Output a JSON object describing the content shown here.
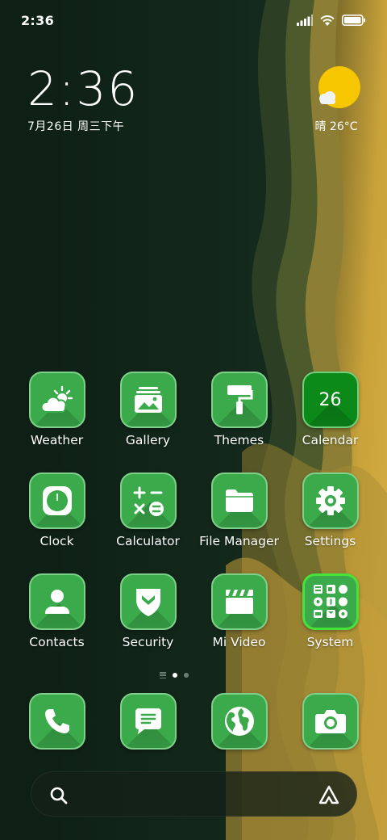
{
  "status_bar": {
    "time": "2:36",
    "icons": [
      "signal-icon",
      "wifi-icon",
      "battery-icon"
    ]
  },
  "clock_widget": {
    "time": "2:36",
    "date": "7月26日 周三下午"
  },
  "weather_widget": {
    "condition_icon": "sunny-cloud-icon",
    "text": "晴 26°C"
  },
  "apps": [
    {
      "id": "weather",
      "label": "Weather",
      "icon": "weather-icon"
    },
    {
      "id": "gallery",
      "label": "Gallery",
      "icon": "gallery-icon"
    },
    {
      "id": "themes",
      "label": "Themes",
      "icon": "paint-roller-icon"
    },
    {
      "id": "calendar",
      "label": "Calendar",
      "icon": "calendar-icon",
      "day": "26"
    },
    {
      "id": "clock",
      "label": "Clock",
      "icon": "clock-icon"
    },
    {
      "id": "calculator",
      "label": "Calculator",
      "icon": "calculator-icon"
    },
    {
      "id": "file-manager",
      "label": "File Manager",
      "icon": "folder-icon"
    },
    {
      "id": "settings",
      "label": "Settings",
      "icon": "gear-icon"
    },
    {
      "id": "contacts",
      "label": "Contacts",
      "icon": "person-icon"
    },
    {
      "id": "security",
      "label": "Security",
      "icon": "shield-icon"
    },
    {
      "id": "mi-video",
      "label": "Mi Video",
      "icon": "clapperboard-icon"
    },
    {
      "id": "system",
      "label": "System",
      "icon": "folder-grid-icon"
    }
  ],
  "page_indicator": {
    "pages": 2,
    "current": 1
  },
  "dock": [
    {
      "id": "phone",
      "icon": "phone-icon"
    },
    {
      "id": "messages",
      "icon": "message-icon"
    },
    {
      "id": "browser",
      "icon": "globe-icon"
    },
    {
      "id": "camera",
      "icon": "camera-icon"
    }
  ],
  "search_bar": {
    "left_icon": "search-icon",
    "right_icon": "assistant-icon"
  },
  "colors": {
    "icon_green": "#3aaa4a",
    "icon_border": "#7fd08a",
    "calendar_green": "#0b8a1a",
    "system_highlight": "#47e33a",
    "sun_yellow": "#f6c600",
    "wallpaper_dark": "#0f2318",
    "wallpaper_gold": "#c9a23a"
  }
}
